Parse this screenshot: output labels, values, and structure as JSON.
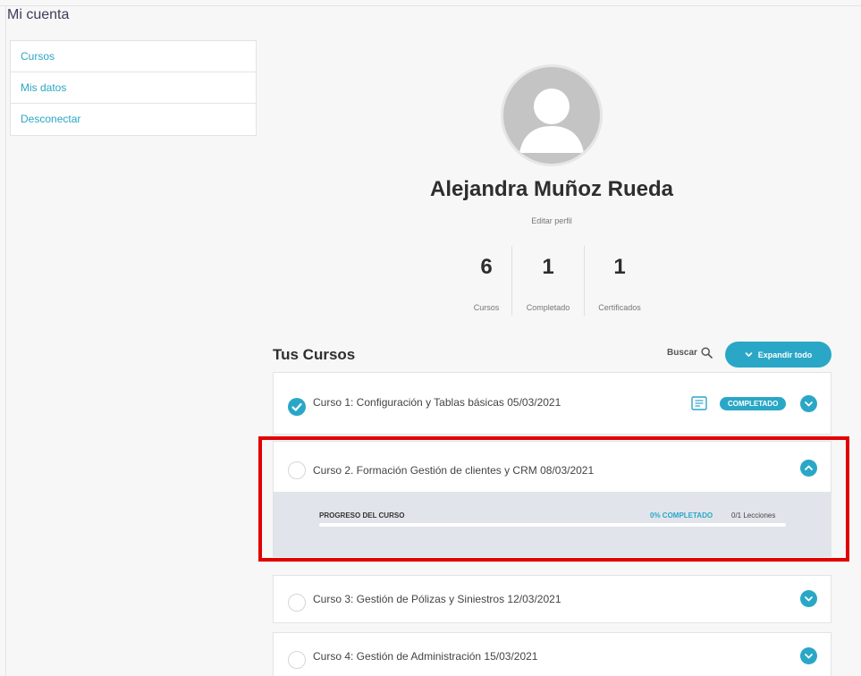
{
  "page": {
    "title": "Mi cuenta"
  },
  "sidebar": {
    "items": [
      {
        "label": "Cursos"
      },
      {
        "label": "Mis datos"
      },
      {
        "label": "Desconectar"
      }
    ]
  },
  "profile": {
    "name": "Alejandra Muñoz Rueda",
    "edit_label": "Editar perfil",
    "avatar_icon": "user-avatar-icon"
  },
  "stats": [
    {
      "value": "6",
      "label": "Cursos"
    },
    {
      "value": "1",
      "label": "Completado"
    },
    {
      "value": "1",
      "label": "Certificados"
    }
  ],
  "courses_section": {
    "title": "Tus Cursos",
    "search_label": "Buscar",
    "expand_label": "Expandir todo"
  },
  "courses": [
    {
      "title": "Curso 1: Configuración y Tablas básicas 05/03/2021",
      "status": "completed",
      "badge": "COMPLETADO"
    },
    {
      "title": "Curso 2. Formación Gestión de clientes y CRM 08/03/2021",
      "status": "in-progress",
      "expanded": true
    },
    {
      "title": "Curso 3: Gestión de Pólizas y Siniestros 12/03/2021",
      "status": "not-started"
    },
    {
      "title": "Curso 4: Gestión de Administración 15/03/2021",
      "status": "not-started"
    }
  ],
  "progress": {
    "label": "PROGRESO DEL CURSO",
    "percent_text": "0% COMPLETADO",
    "percent_value": 0,
    "lessons": "0/1 Lecciones"
  },
  "colors": {
    "accent": "#2aa7c6",
    "highlight": "#e20000",
    "panel": "#e1e4ea"
  }
}
